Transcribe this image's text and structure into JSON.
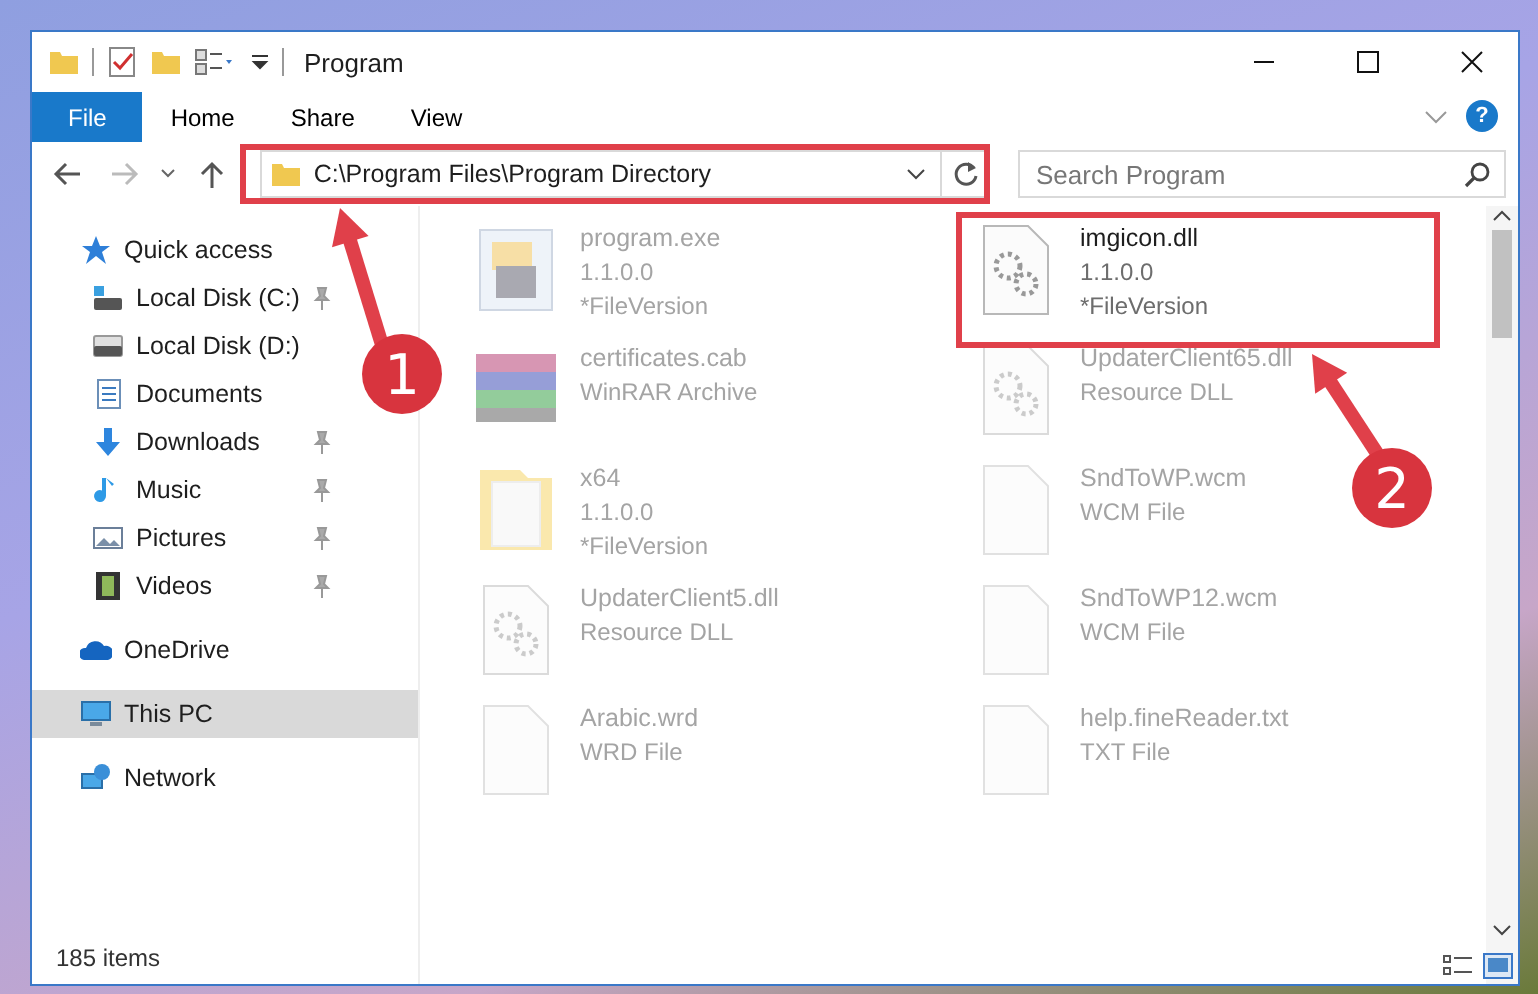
{
  "window": {
    "title": "Program"
  },
  "ribbon": {
    "tabs": [
      {
        "label": "File",
        "kind": "file"
      },
      {
        "label": "Home",
        "kind": "tab"
      },
      {
        "label": "Share",
        "kind": "tab"
      },
      {
        "label": "View",
        "kind": "tab"
      }
    ],
    "help_glyph": "?"
  },
  "address_bar": {
    "path": "C:\\Program Files\\Program Directory"
  },
  "search": {
    "placeholder": "Search Program"
  },
  "nav": {
    "items": [
      {
        "label": "Quick access",
        "kind": "star",
        "selected": false,
        "children": [
          {
            "label": "Local Disk (C:)",
            "kind": "drive-c",
            "pinned": true,
            "selected": false
          },
          {
            "label": "Local Disk (D:)",
            "kind": "drive",
            "pinned": false,
            "selected": false
          },
          {
            "label": "Documents",
            "kind": "document",
            "pinned": false,
            "selected": false
          },
          {
            "label": "Downloads",
            "kind": "download",
            "pinned": true,
            "selected": false
          },
          {
            "label": "Music",
            "kind": "music",
            "pinned": true,
            "selected": false
          },
          {
            "label": "Pictures",
            "kind": "picture",
            "pinned": true,
            "selected": false
          },
          {
            "label": "Videos",
            "kind": "video",
            "pinned": true,
            "selected": false
          }
        ]
      },
      {
        "label": "OneDrive",
        "kind": "cloud",
        "selected": false
      },
      {
        "label": "This PC",
        "kind": "monitor",
        "selected": true
      },
      {
        "label": "Network",
        "kind": "network",
        "selected": false
      }
    ]
  },
  "files": [
    {
      "name": "program.exe",
      "details": [
        "1.1.0.0",
        "*FileVersion"
      ],
      "kind": "exe",
      "highlighted": false
    },
    {
      "name": "imgicon.dll",
      "details": [
        "1.1.0.0",
        "*FileVersion"
      ],
      "kind": "dll",
      "highlighted": true
    },
    {
      "name": "certificates.cab",
      "details": [
        "WinRAR Archive"
      ],
      "kind": "archive",
      "highlighted": false
    },
    {
      "name": "UpdaterClient65.dll",
      "details": [
        "Resource DLL"
      ],
      "kind": "dll",
      "highlighted": false
    },
    {
      "name": "x64",
      "details": [
        "1.1.0.0",
        "*FileVersion"
      ],
      "kind": "folder",
      "highlighted": false
    },
    {
      "name": "SndToWP.wcm",
      "details": [
        "WCM File"
      ],
      "kind": "doc",
      "highlighted": false
    },
    {
      "name": "UpdaterClient5.dll",
      "details": [
        "Resource DLL"
      ],
      "kind": "dll",
      "highlighted": false
    },
    {
      "name": "SndToWP12.wcm",
      "details": [
        "WCM File"
      ],
      "kind": "doc",
      "highlighted": false
    },
    {
      "name": "Arabic.wrd",
      "details": [
        "WRD File"
      ],
      "kind": "doc",
      "highlighted": false
    },
    {
      "name": "help.fineReader.txt",
      "details": [
        "TXT File"
      ],
      "kind": "doc",
      "highlighted": false
    }
  ],
  "status_bar": {
    "item_count": "185 items"
  },
  "annotations": [
    {
      "label": "1"
    },
    {
      "label": "2"
    }
  ]
}
